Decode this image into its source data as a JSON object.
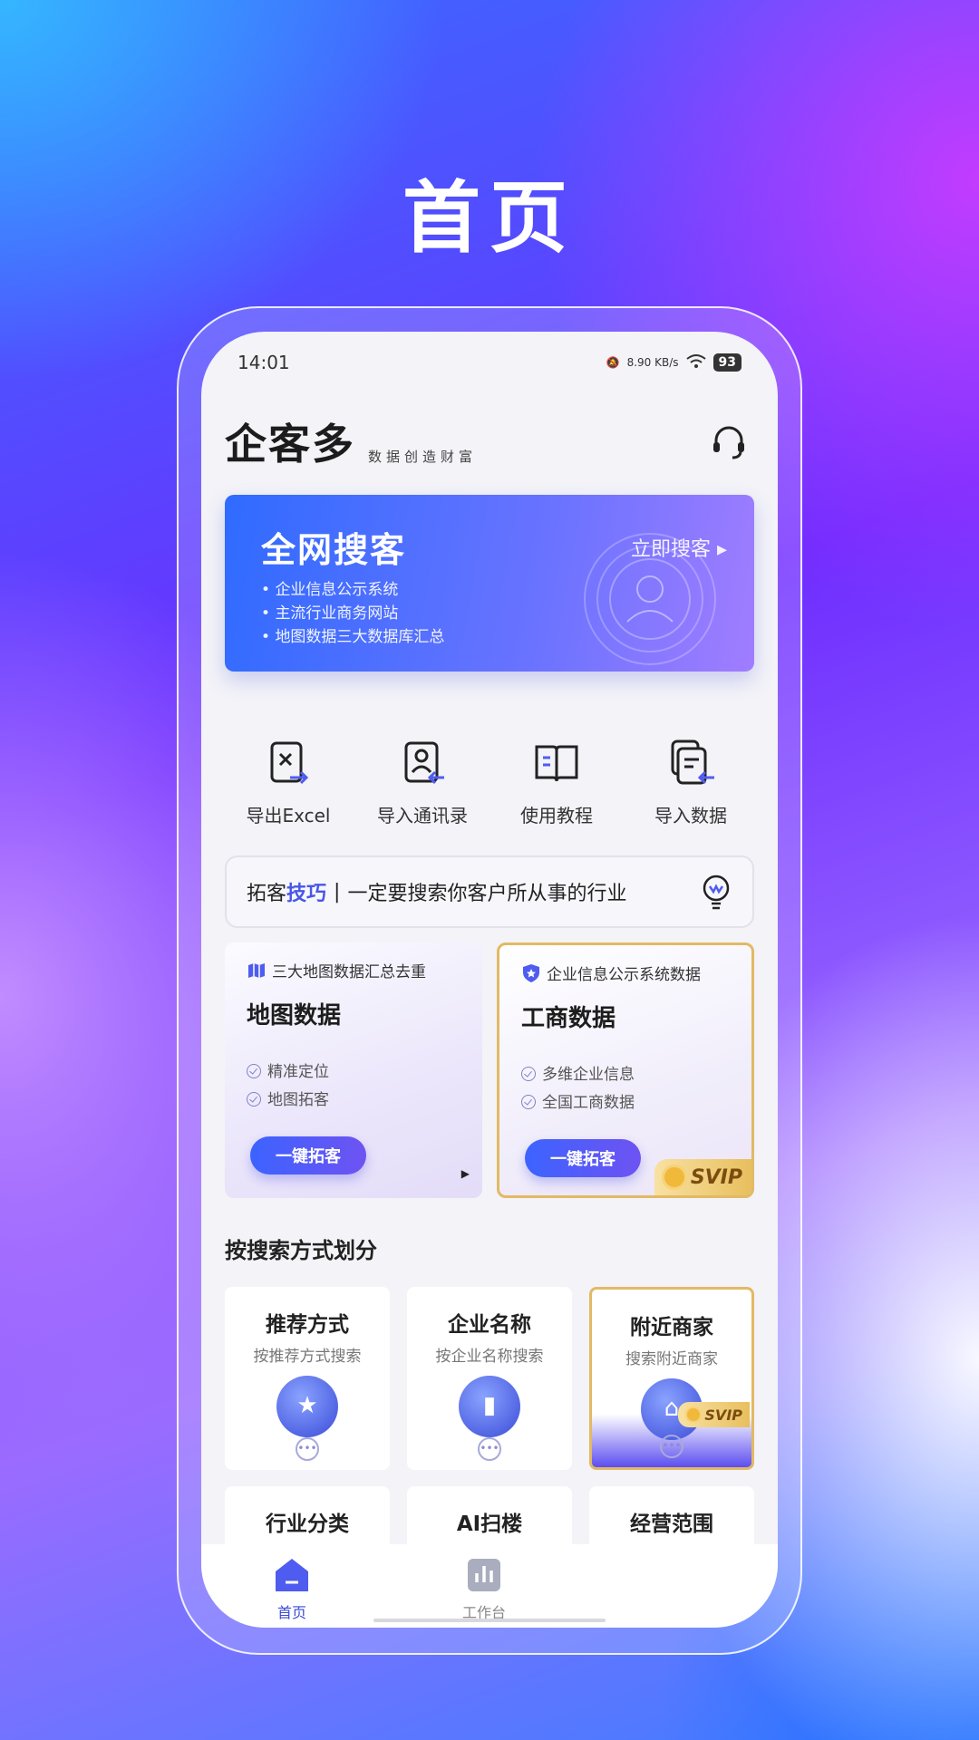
{
  "promo": {
    "headline": "首页"
  },
  "status_bar": {
    "time": "14:01",
    "net_speed": "8.90 KB/s",
    "battery": "93"
  },
  "header": {
    "app_name": "企客多",
    "slogan": "数据创造财富"
  },
  "banner": {
    "title": "全网搜客",
    "cta": "立即搜客 ▸",
    "items": [
      "企业信息公示系统",
      "主流行业商务网站",
      "地图数据三大数据库汇总"
    ]
  },
  "quick_actions": [
    {
      "label": "导出Excel",
      "icon": "excel-export-icon"
    },
    {
      "label": "导入通讯录",
      "icon": "contacts-import-icon"
    },
    {
      "label": "使用教程",
      "icon": "book-icon"
    },
    {
      "label": "导入数据",
      "icon": "data-import-icon"
    }
  ],
  "tip": {
    "prefix": "拓客",
    "accent": "技巧",
    "separator": "|",
    "text": "一定要搜索你客户所从事的行业"
  },
  "features": [
    {
      "tag": "三大地图数据汇总去重",
      "title": "地图数据",
      "points": [
        "精准定位",
        "地图拓客"
      ],
      "button": "一键拓客",
      "icon": "map-icon"
    },
    {
      "tag": "企业信息公示系统数据",
      "title": "工商数据",
      "points": [
        "多维企业信息",
        "全国工商数据"
      ],
      "button": "一键拓客",
      "badge": "SVIP",
      "icon": "shield-star-icon"
    }
  ],
  "section": {
    "title": "按搜索方式划分"
  },
  "categories_row1": [
    {
      "title": "推荐方式",
      "subtitle": "按推荐方式搜索",
      "icon": "star-icon"
    },
    {
      "title": "企业名称",
      "subtitle": "按企业名称搜索",
      "icon": "building-icon"
    },
    {
      "title": "附近商家",
      "subtitle": "搜索附近商家",
      "icon": "store-icon",
      "badge": "SVIP"
    }
  ],
  "categories_row2": [
    {
      "title": "行业分类"
    },
    {
      "title": "AI扫楼"
    },
    {
      "title": "经营范围"
    }
  ],
  "tabbar": [
    {
      "label": "首页",
      "icon": "home-icon",
      "active": true
    },
    {
      "label": "工作台",
      "icon": "chart-icon",
      "active": false
    }
  ],
  "colors": {
    "accent": "#3a4bd8",
    "gold": "#e2b964"
  }
}
